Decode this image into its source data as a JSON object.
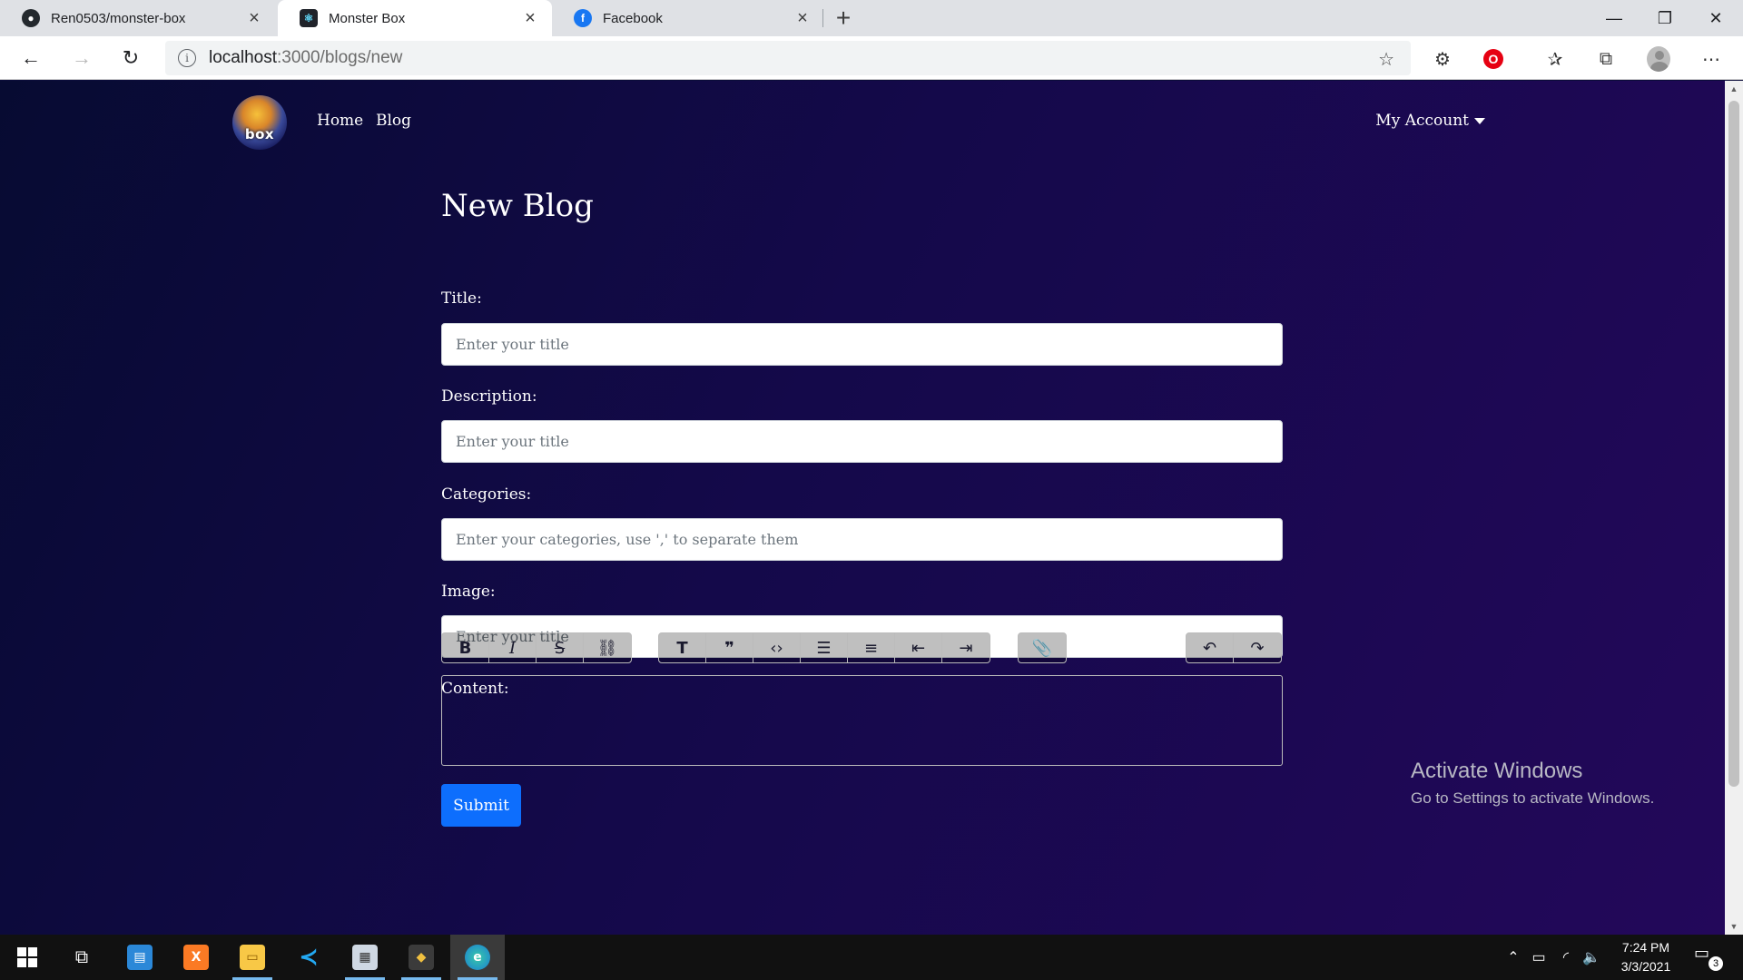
{
  "browser": {
    "tabs": [
      {
        "title": "Ren0503/monster-box",
        "favicon": "github-icon"
      },
      {
        "title": "Monster Box",
        "favicon": "react-icon"
      },
      {
        "title": "Facebook",
        "favicon": "facebook-icon"
      }
    ],
    "url_host": "localhost",
    "url_path": ":3000/blogs/new"
  },
  "site": {
    "logo_text": "box",
    "nav": {
      "home": "Home",
      "blog": "Blog",
      "account": "My Account"
    }
  },
  "form": {
    "heading": "New Blog",
    "title_label": "Title:",
    "title_placeholder": "Enter your title",
    "description_label": "Description:",
    "description_placeholder": "Enter your title",
    "categories_label": "Categories:",
    "categories_placeholder": "Enter your categories, use ',' to separate them",
    "image_label": "Image:",
    "image_placeholder": "Enter your title",
    "content_label": "Content:",
    "submit": "Submit"
  },
  "editor_toolbar": {
    "groups": [
      [
        "bold-icon",
        "italic-icon",
        "strikethrough-icon",
        "link-icon"
      ],
      [
        "heading-icon",
        "quote-icon",
        "code-icon",
        "bullet-list-icon",
        "numbered-list-icon",
        "decrease-indent-icon",
        "increase-indent-icon"
      ],
      [
        "attach-file-icon"
      ],
      [
        "undo-icon",
        "redo-icon"
      ]
    ]
  },
  "watermark": {
    "line1": "Activate Windows",
    "line2": "Go to Settings to activate Windows."
  },
  "taskbar": {
    "time": "7:24 PM",
    "date": "3/3/2021",
    "notifications": "3"
  },
  "colors": {
    "page_bg_start": "#070b32",
    "page_bg_end": "#23085a",
    "submit_bg": "#0d6efd"
  }
}
